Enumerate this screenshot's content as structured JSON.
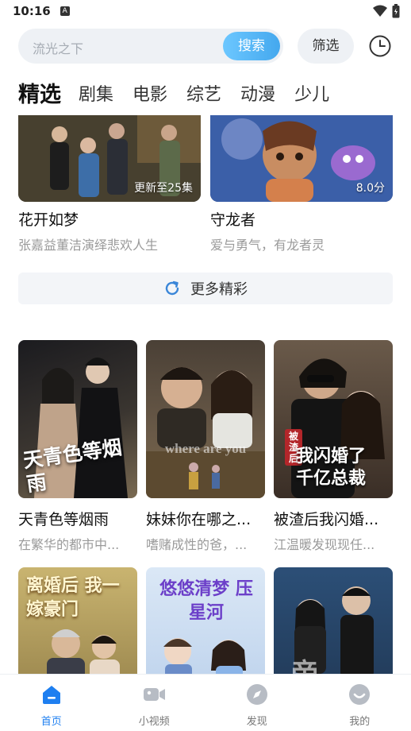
{
  "status_bar": {
    "time": "10:16"
  },
  "search": {
    "placeholder": "流光之下",
    "button_label": "搜索",
    "filter_label": "筛选"
  },
  "tabs": [
    "精选",
    "剧集",
    "电影",
    "综艺",
    "动漫",
    "少儿"
  ],
  "top_cards": [
    {
      "title": "花开如梦",
      "desc": "张嘉益董洁演绎悲欢人生",
      "badge": "更新至25集"
    },
    {
      "title": "守龙者",
      "desc": "爱与勇气，有龙者灵",
      "badge": "8.0分"
    }
  ],
  "more_label": "更多精彩",
  "grid_cards": [
    {
      "title": "天青色等烟雨",
      "desc": "在繁华的都市中...",
      "poster_text": "天青色等烟雨"
    },
    {
      "title": "妹妹你在哪之...",
      "desc": "嗜赌成性的爸，...",
      "poster_text": "where are you"
    },
    {
      "title": "被渣后我闪婚...",
      "desc": "江温暖发现现任...",
      "poster_text": "我闪婚了 千亿总裁",
      "poster_tag": "被渣后"
    },
    {
      "title": "",
      "desc": "",
      "poster_text": "离婚后 我一嫁豪门"
    },
    {
      "title": "",
      "desc": "",
      "poster_text": "悠悠清梦 压星河"
    },
    {
      "title": "",
      "desc": "",
      "poster_text": "帝"
    }
  ],
  "nav": [
    {
      "label": "首页",
      "icon": "home-icon"
    },
    {
      "label": "小视频",
      "icon": "video-icon"
    },
    {
      "label": "发现",
      "icon": "compass-icon"
    },
    {
      "label": "我的",
      "icon": "profile-icon"
    }
  ],
  "colors": {
    "accent": "#1e7ff0",
    "search_button": "#44a8ee"
  }
}
